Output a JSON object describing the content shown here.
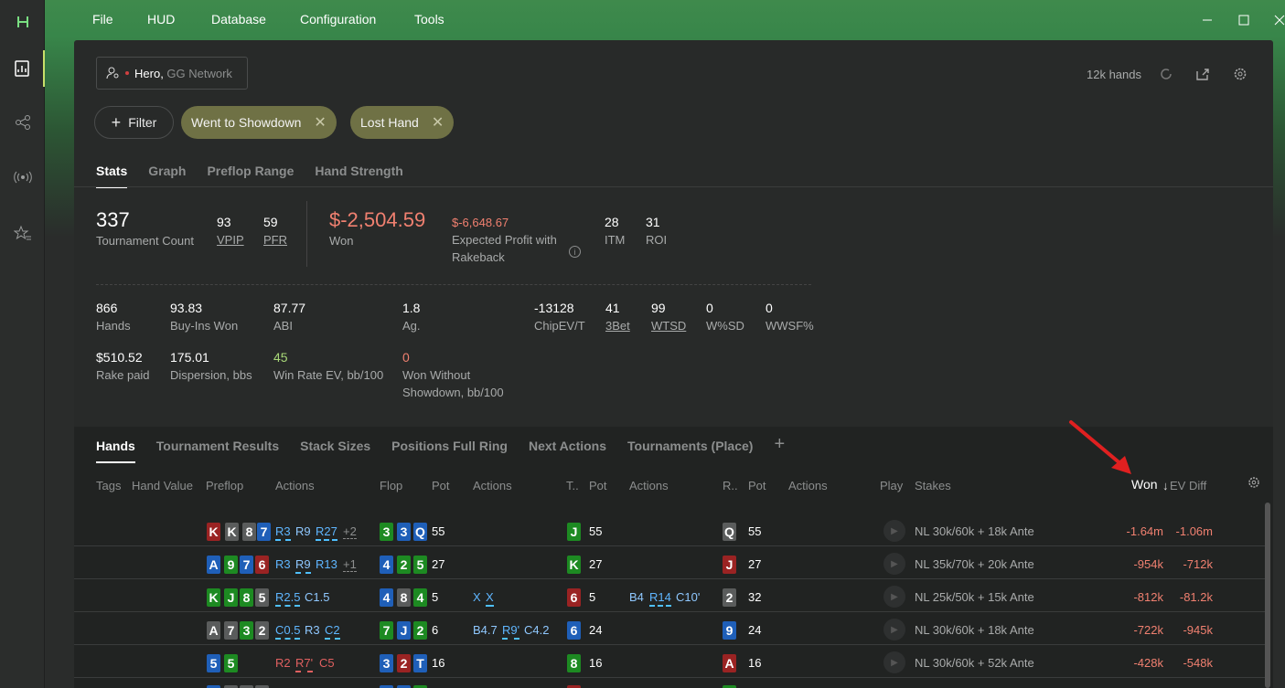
{
  "menu": [
    "File",
    "HUD",
    "Database",
    "Configuration",
    "Tools"
  ],
  "player": {
    "name": "Hero",
    "network": "GG Network"
  },
  "hands_count": "12k hands",
  "filter_label": "Filter",
  "chips": [
    "Went to Showdown",
    "Lost Hand"
  ],
  "tabs": [
    "Stats",
    "Graph",
    "Preflop Range",
    "Hand Strength"
  ],
  "stats": {
    "tournament_count": "337",
    "tournament_count_label": "Tournament Count",
    "vpip": "93",
    "vpip_label": "VPIP",
    "pfr": "59",
    "pfr_label": "PFR",
    "won": "$-2,504.59",
    "won_label": "Won",
    "expected": "$-6,648.67",
    "expected_label1": "Expected Profit with",
    "expected_label2": "Rakeback",
    "itm": "28",
    "itm_label": "ITM",
    "roi": "31",
    "roi_label": "ROI",
    "hands": "866",
    "hands_label": "Hands",
    "buyins": "93.83",
    "buyins_label": "Buy-Ins Won",
    "abi": "87.77",
    "abi_label": "ABI",
    "ag": "1.8",
    "ag_label": "Ag.",
    "chipev": "-13128",
    "chipev_label": "ChipEV/T",
    "threebet": "41",
    "threebet_label": "3Bet",
    "wtsd": "99",
    "wtsd_label": "WTSD",
    "wsd": "0",
    "wsd_label": "W%SD",
    "wwsf": "0",
    "wwsf_label": "WWSF%",
    "rake": "$510.52",
    "rake_label": "Rake paid",
    "dispersion": "175.01",
    "dispersion_label": "Dispersion, bbs",
    "winrate": "45",
    "winrate_label": "Win Rate EV, bb/100",
    "wonwo": "0",
    "wonwo_label1": "Won Without",
    "wonwo_label2": "Showdown, bb/100"
  },
  "hand_tabs": [
    "Hands",
    "Tournament Results",
    "Stack Sizes",
    "Positions Full Ring",
    "Next Actions",
    "Tournaments (Place)"
  ],
  "columns": {
    "tags": "Tags",
    "hand_value": "Hand Value",
    "preflop": "Preflop",
    "actions": "Actions",
    "flop": "Flop",
    "pot": "Pot",
    "turn": "T..",
    "river": "R..",
    "play": "Play",
    "stakes": "Stakes",
    "won": "Won",
    "evdiff": "EV Diff"
  },
  "rows": [
    {
      "stakes": "NL 30k/60k + 18k Ante",
      "won": "-1.64m",
      "ev": "-1.06m",
      "pot1": "55",
      "pot2": "55",
      "pot3": "55"
    },
    {
      "stakes": "NL 35k/70k + 20k Ante",
      "won": "-954k",
      "ev": "-712k",
      "pot1": "27",
      "pot2": "27",
      "pot3": "27"
    },
    {
      "stakes": "NL 25k/50k + 15k Ante",
      "won": "-812k",
      "ev": "-81.2k",
      "pot1": "5",
      "pot2": "5",
      "pot3": "32"
    },
    {
      "stakes": "NL 30k/60k + 18k Ante",
      "won": "-722k",
      "ev": "-945k",
      "pot1": "6",
      "pot2": "24",
      "pot3": "24"
    },
    {
      "stakes": "NL 30k/60k + 52k Ante",
      "won": "-428k",
      "ev": "-548k",
      "pot1": "16",
      "pot2": "16",
      "pot3": "16"
    }
  ]
}
